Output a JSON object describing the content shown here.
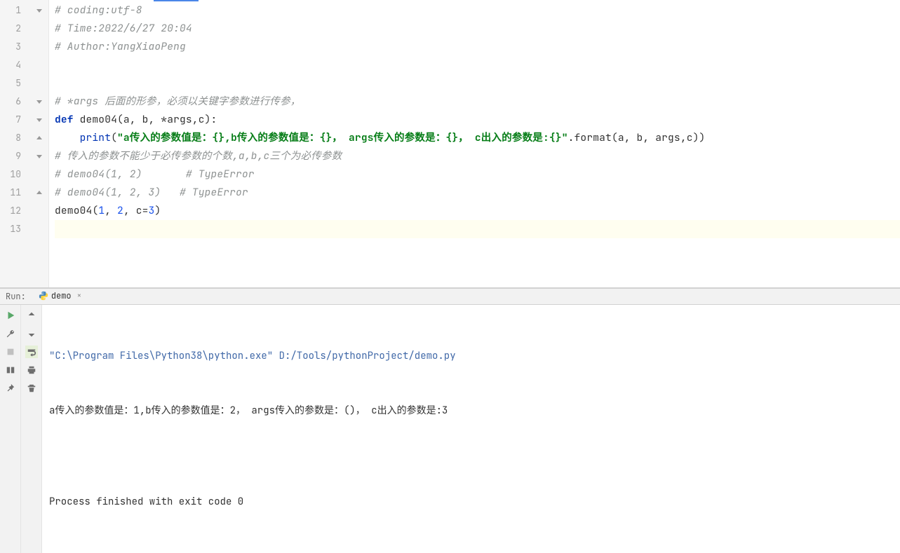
{
  "editor": {
    "lines": [
      {
        "num": 1,
        "fold": "open",
        "segments": [
          {
            "cls": "comment",
            "text": "# coding:utf-8"
          }
        ]
      },
      {
        "num": 2,
        "fold": "",
        "segments": [
          {
            "cls": "comment",
            "text": "# Time:2022/6/27 20:04"
          }
        ]
      },
      {
        "num": 3,
        "fold": "",
        "segments": [
          {
            "cls": "comment",
            "text": "# Author:YangXiaoPeng"
          }
        ]
      },
      {
        "num": 4,
        "fold": "",
        "segments": []
      },
      {
        "num": 5,
        "fold": "",
        "segments": []
      },
      {
        "num": 6,
        "fold": "open",
        "segments": [
          {
            "cls": "comment",
            "text": "# *args 后面的形参，必须以关键字参数进行传参，"
          }
        ]
      },
      {
        "num": 7,
        "fold": "open",
        "segments": [
          {
            "cls": "keyword",
            "text": "def "
          },
          {
            "cls": "funcdef",
            "text": "demo04(a, b, *args,c):"
          }
        ]
      },
      {
        "num": 8,
        "fold": "close",
        "segments": [
          {
            "cls": "plain",
            "text": "    "
          },
          {
            "cls": "builtin",
            "text": "print"
          },
          {
            "cls": "plain",
            "text": "("
          },
          {
            "cls": "string",
            "text": "\"a传入的参数值是：{},b传入的参数值是：{}， args传入的参数是：{}， c出入的参数是:{}\""
          },
          {
            "cls": "plain",
            "text": ".format(a, b, args,c))"
          }
        ]
      },
      {
        "num": 9,
        "fold": "open",
        "segments": [
          {
            "cls": "comment",
            "text": "# 传入的参数不能少于必传参数的个数,a,b,c三个为必传参数"
          }
        ]
      },
      {
        "num": 10,
        "fold": "",
        "segments": [
          {
            "cls": "comment",
            "text": "# demo04(1, 2)       # TypeError"
          }
        ]
      },
      {
        "num": 11,
        "fold": "close",
        "segments": [
          {
            "cls": "comment",
            "text": "# demo04(1, 2, 3)   # TypeError"
          }
        ]
      },
      {
        "num": 12,
        "fold": "",
        "segments": [
          {
            "cls": "plain",
            "text": "demo04("
          },
          {
            "cls": "number",
            "text": "1"
          },
          {
            "cls": "plain",
            "text": ", "
          },
          {
            "cls": "number",
            "text": "2"
          },
          {
            "cls": "plain",
            "text": ", "
          },
          {
            "cls": "param",
            "text": "c="
          },
          {
            "cls": "number",
            "text": "3"
          },
          {
            "cls": "plain",
            "text": ")"
          }
        ]
      },
      {
        "num": 13,
        "fold": "",
        "current": true,
        "segments": []
      }
    ]
  },
  "run": {
    "label": "Run:",
    "tab_name": "demo",
    "console": {
      "cmd": "\"C:\\Program Files\\Python38\\python.exe\" D:/Tools/pythonProject/demo.py",
      "output": "a传入的参数值是：1,b传入的参数值是：2， args传入的参数是：()， c出入的参数是:3",
      "blank": "",
      "exit": "Process finished with exit code 0"
    }
  }
}
